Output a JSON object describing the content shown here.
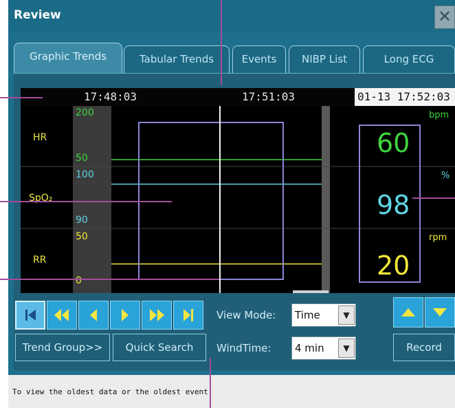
{
  "window": {
    "title": "Review",
    "close_glyph": "✕"
  },
  "tabs": [
    {
      "label": "Graphic Trends",
      "active": true
    },
    {
      "label": "Tabular Trends",
      "active": false
    },
    {
      "label": "Events",
      "active": false
    },
    {
      "label": "NIBP List",
      "active": false
    },
    {
      "label": "Long ECG",
      "active": false
    }
  ],
  "timebar": {
    "t1": "17:48:03",
    "t2": "17:51:03",
    "current": "01-13 17:52:03"
  },
  "params": [
    {
      "name": "HR",
      "scale_top": "200",
      "scale_bottom": "50",
      "unit": "bpm",
      "value": "60",
      "color": "#3dd63d",
      "trend_value": 50
    },
    {
      "name": "SpO₂",
      "scale_top": "100",
      "scale_bottom": "90",
      "unit": "%",
      "value": "98",
      "color": "#5fd5e6",
      "trend_value": 98
    },
    {
      "name": "RR",
      "scale_top": "50",
      "scale_bottom": "0",
      "unit": "rpm",
      "value": "20",
      "color": "#f2e83a",
      "trend_value": 20
    }
  ],
  "nav": {
    "first": "first-icon",
    "fast_back": "fast-back-icon",
    "back": "back-icon",
    "forward": "forward-icon",
    "fast_forward": "fast-forward-icon",
    "last": "last-icon"
  },
  "controls": {
    "view_mode_label": "View Mode:",
    "view_mode_value": "Time",
    "wind_time_label": "WindTime:",
    "wind_time_value": "4 min",
    "trend_group_label": "Trend Group>>",
    "quick_search_label": "Quick Search",
    "record_label": "Record"
  },
  "status": {
    "text": "To view the oldest data or the oldest event."
  },
  "colors": {
    "accent": "#2aa3d8",
    "callout": "#a44c9a"
  }
}
